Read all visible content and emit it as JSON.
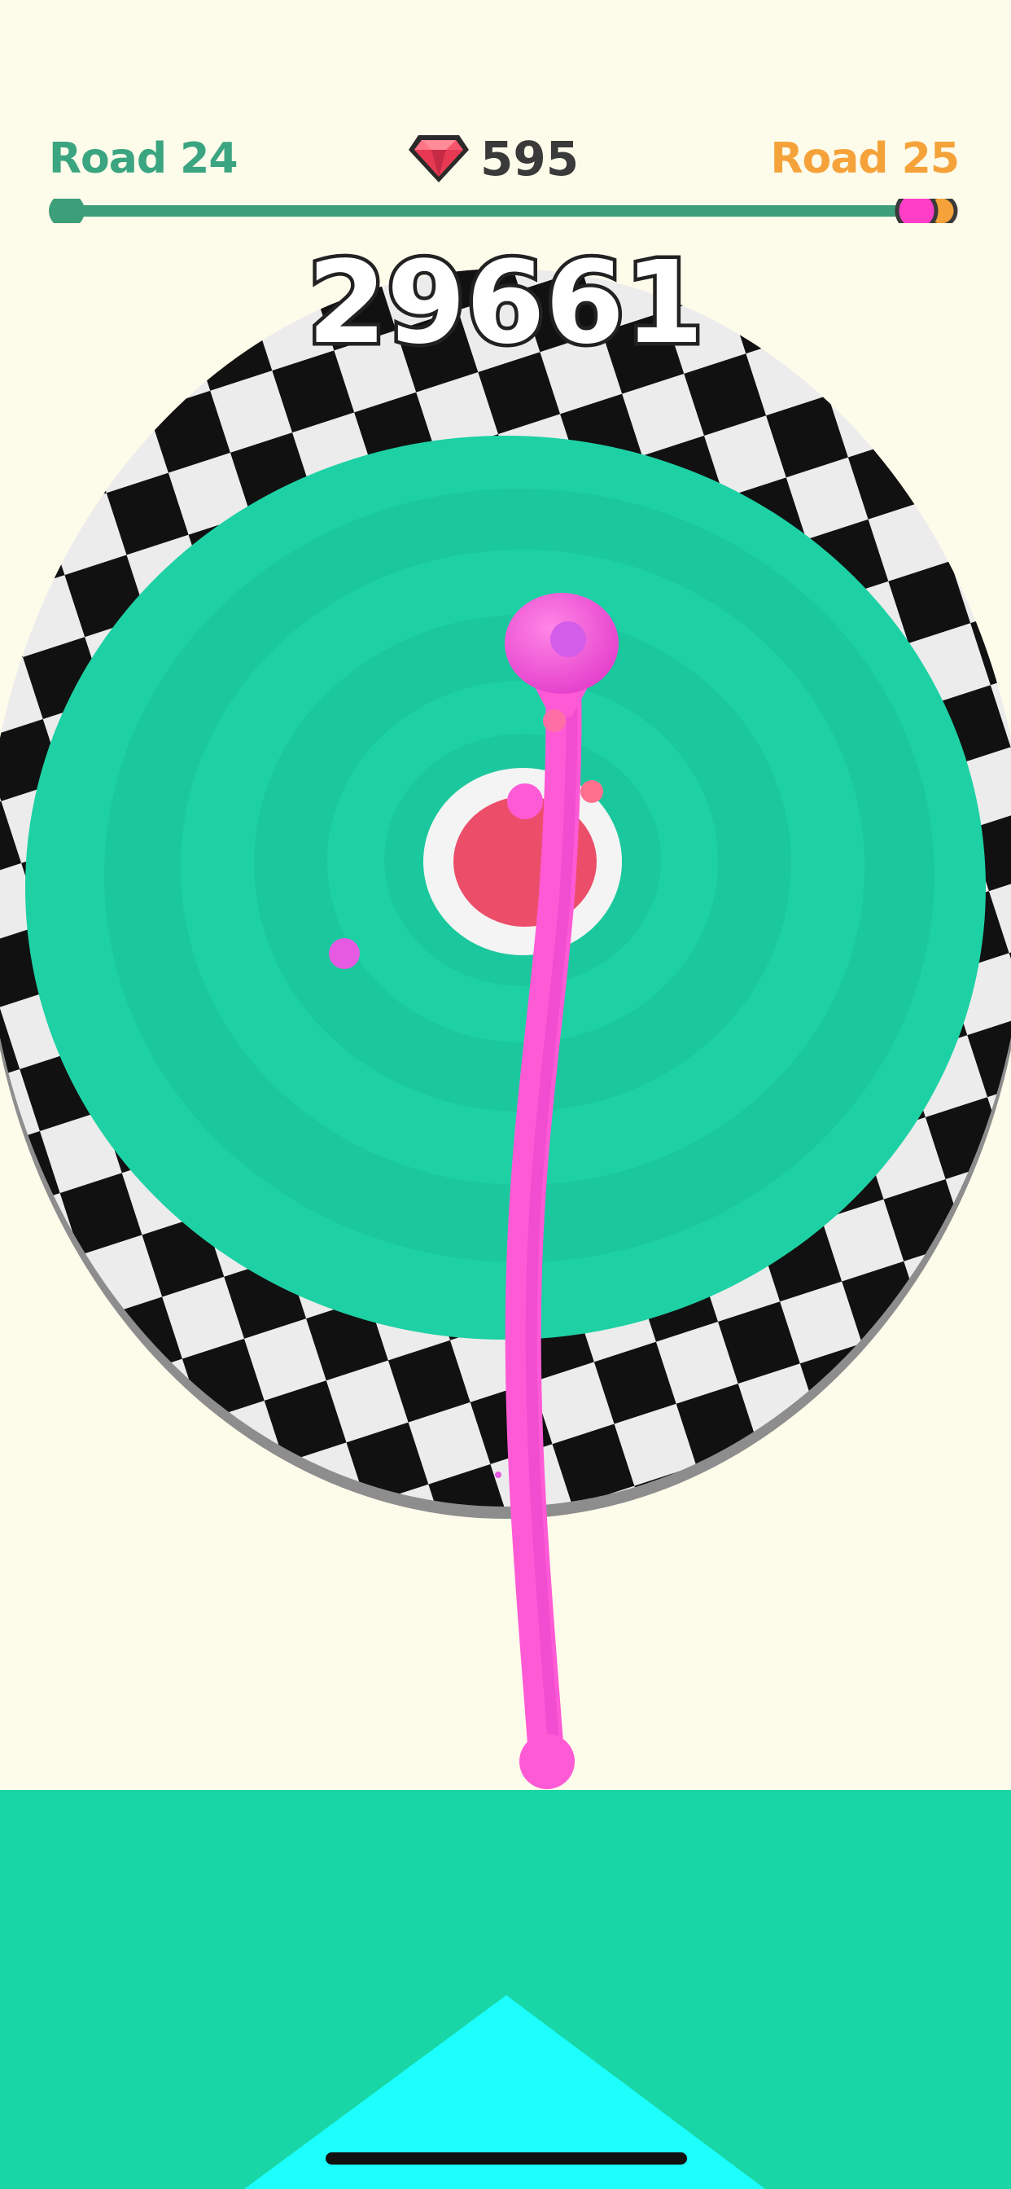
{
  "hud": {
    "current_road": "Road 24",
    "next_road": "Road 25",
    "gem_count": "595",
    "score": "29661",
    "level_progress": 1.0,
    "gem_icon": "red-gem-icon"
  },
  "colors": {
    "background": "#fdfbea",
    "road_current": "#3aa580",
    "road_next": "#f5a23a",
    "progress_track": "#3d9e7a",
    "snake": "#ff5ad6",
    "target_red": "#ec4e6a",
    "disc_teal": "#1ecfa2",
    "floor_teal": "#18d6a6",
    "ramp_cyan": "#1cfffc"
  }
}
